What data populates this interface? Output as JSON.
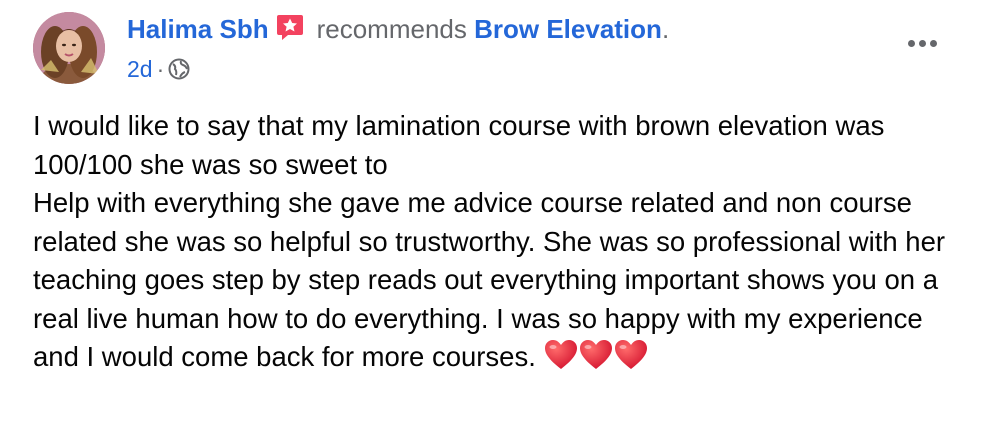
{
  "post": {
    "author": "Halima Sbh",
    "recommend_icon": "recommend-icon",
    "verb": "recommends",
    "page_name": "Brow Elevation",
    "page_suffix": ".",
    "time": "2d",
    "separator": "·",
    "privacy_icon": "globe-icon",
    "more_icon": "more-options-icon",
    "body_lines": [
      "I would like to say that my lamination course with brown elevation was 100/100 she was so sweet to",
      "Help with everything she gave me advice course related and non course related she was so helpful so trustworthy. She was so professional with her teaching goes step by step reads out everything important shows you on a real live human how to do everything. I was so happy with my experience and I would come back for more courses."
    ],
    "emoji": [
      "heart-icon",
      "heart-icon",
      "heart-icon"
    ]
  },
  "colors": {
    "link_blue": "#2467d8",
    "meta_gray": "#65676b",
    "recommend_red": "#f3425f",
    "heart_red": "#e0243a"
  }
}
